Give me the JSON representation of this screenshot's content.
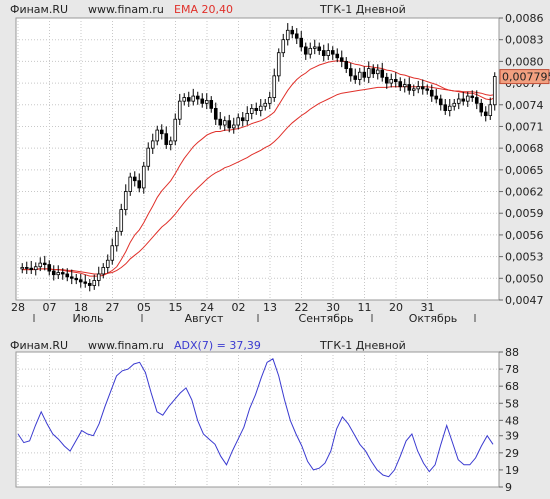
{
  "top_panel": {
    "source": "Финам.RU",
    "site": "www.finam.ru",
    "indicator": "EMA 20,40",
    "title": "ТГК-1 Дневной",
    "last_price": "0,007795"
  },
  "bottom_panel": {
    "source": "Финам.RU",
    "site": "www.finam.ru",
    "indicator": "ADX(7) = 37,39",
    "title": "ТГК-1 Дневной"
  },
  "colors": {
    "background": "#e8e8e8",
    "plot_bg": "#ffffff",
    "grid": "#c8c8c8",
    "ema": "#e0302a",
    "adx": "#3a3ad0",
    "candle_up": "#ffffff",
    "candle_down": "#000000",
    "price_tag": "#f2a080"
  },
  "chart_data": [
    {
      "type": "candlestick",
      "title": "ТГК-1 Дневной",
      "ylim": [
        0.0047,
        0.0086
      ],
      "y_ticks": [
        "0,0086",
        "0,0083",
        "0,0080",
        "0,0077",
        "0,0074",
        "0,0071",
        "0,0068",
        "0,0065",
        "0,0062",
        "0,0059",
        "0,0056",
        "0,0053",
        "0,0050",
        "0,0047"
      ],
      "x_day_ticks": [
        "28",
        "07",
        "18",
        "27",
        "05",
        "15",
        "24",
        "02",
        "13",
        "22",
        "30",
        "11",
        "20",
        "31"
      ],
      "x_month_labels": [
        "Июль",
        "Август",
        "Сентябрь",
        "Октябрь"
      ],
      "grid": true,
      "close": [
        0.00515,
        0.00514,
        0.00512,
        0.00516,
        0.00521,
        0.00519,
        0.0051,
        0.00505,
        0.00508,
        0.00506,
        0.00502,
        0.005,
        0.00498,
        0.00495,
        0.00493,
        0.0049,
        0.00497,
        0.00506,
        0.00515,
        0.00525,
        0.00545,
        0.00565,
        0.00595,
        0.0062,
        0.0064,
        0.00635,
        0.00625,
        0.00655,
        0.0068,
        0.0069,
        0.00705,
        0.007,
        0.00685,
        0.0069,
        0.0072,
        0.00745,
        0.0075,
        0.00745,
        0.00752,
        0.00748,
        0.00742,
        0.00746,
        0.00735,
        0.0072,
        0.00712,
        0.00718,
        0.00708,
        0.00712,
        0.00722,
        0.00718,
        0.00728,
        0.00735,
        0.00732,
        0.00738,
        0.00742,
        0.0075,
        0.0078,
        0.00812,
        0.0083,
        0.00843,
        0.00838,
        0.00832,
        0.0082,
        0.0081,
        0.00818,
        0.0082,
        0.00815,
        0.00808,
        0.00815,
        0.0081,
        0.00805,
        0.008,
        0.0079,
        0.0078,
        0.00775,
        0.00785,
        0.00778,
        0.0079,
        0.00783,
        0.00788,
        0.00778,
        0.0077,
        0.00775,
        0.00772,
        0.00765,
        0.00768,
        0.0076,
        0.00762,
        0.00765,
        0.00762,
        0.0076,
        0.00752,
        0.00748,
        0.0074,
        0.00732,
        0.00738,
        0.00742,
        0.00748,
        0.00745,
        0.00752,
        0.0075,
        0.00742,
        0.0073,
        0.00725,
        0.0074,
        0.00779
      ],
      "series": [
        {
          "name": "EMA 20",
          "values": [
            0.00512,
            0.00512,
            0.00512,
            0.00513,
            0.00513,
            0.00513,
            0.00513,
            0.00512,
            0.00512,
            0.00511,
            0.0051,
            0.00509,
            0.00508,
            0.00507,
            0.00505,
            0.00503,
            0.00503,
            0.00503,
            0.00504,
            0.00507,
            0.00511,
            0.00516,
            0.00526,
            0.00537,
            0.0055,
            0.0056,
            0.00567,
            0.00577,
            0.00589,
            0.006,
            0.00612,
            0.00621,
            0.00628,
            0.00635,
            0.00645,
            0.00656,
            0.00666,
            0.00674,
            0.00682,
            0.00688,
            0.00693,
            0.00698,
            0.00701,
            0.00703,
            0.00703,
            0.00705,
            0.00705,
            0.00706,
            0.00707,
            0.00709,
            0.00711,
            0.00714,
            0.00716,
            0.00718,
            0.00721,
            0.00725,
            0.0073,
            0.0074,
            0.0075,
            0.0076,
            0.00768,
            0.00775,
            0.0078,
            0.00784,
            0.00789,
            0.00792,
            0.00795,
            0.00797,
            0.00799,
            0.008,
            0.00801,
            0.008,
            0.008,
            0.00798,
            0.00796,
            0.00795,
            0.00793,
            0.00793,
            0.00792,
            0.00791,
            0.0079,
            0.00788,
            0.00787,
            0.00785,
            0.00782,
            0.00781,
            0.00779,
            0.00777,
            0.00776,
            0.00774,
            0.00772,
            0.0077,
            0.00768,
            0.00765,
            0.00762,
            0.0076,
            0.00759,
            0.00758,
            0.00757,
            0.00756,
            0.00756,
            0.00754,
            0.00751,
            0.00748,
            0.00747,
            0.0075
          ]
        },
        {
          "name": "EMA 40",
          "values": [
            0.00512,
            0.00512,
            0.00512,
            0.00512,
            0.00513,
            0.00513,
            0.00513,
            0.00512,
            0.00512,
            0.00512,
            0.00511,
            0.00511,
            0.0051,
            0.00509,
            0.00508,
            0.00507,
            0.00506,
            0.00506,
            0.00506,
            0.00507,
            0.00508,
            0.00511,
            0.00515,
            0.0052,
            0.00527,
            0.00532,
            0.00537,
            0.00543,
            0.0055,
            0.00557,
            0.00564,
            0.00571,
            0.00576,
            0.00582,
            0.00589,
            0.00597,
            0.00605,
            0.00612,
            0.00619,
            0.00625,
            0.00631,
            0.00637,
            0.00642,
            0.00646,
            0.00649,
            0.00653,
            0.00655,
            0.00658,
            0.00661,
            0.00664,
            0.00667,
            0.00671,
            0.00674,
            0.00677,
            0.00681,
            0.00684,
            0.00689,
            0.00695,
            0.00702,
            0.00709,
            0.00715,
            0.0072,
            0.00725,
            0.00729,
            0.00734,
            0.00738,
            0.00742,
            0.00745,
            0.00748,
            0.00751,
            0.00754,
            0.00756,
            0.00757,
            0.00758,
            0.00759,
            0.0076,
            0.00761,
            0.00762,
            0.00763,
            0.00764,
            0.00764,
            0.00764,
            0.00765,
            0.00765,
            0.00765,
            0.00765,
            0.00765,
            0.00765,
            0.00765,
            0.00765,
            0.00765,
            0.00764,
            0.00763,
            0.00762,
            0.00761,
            0.0076,
            0.00759,
            0.00759,
            0.00758,
            0.00758,
            0.00758,
            0.00757,
            0.00756,
            0.00754,
            0.00753,
            0.00754
          ]
        }
      ]
    },
    {
      "type": "line",
      "title": "ТГК-1 Дневной",
      "ylim": [
        9,
        88
      ],
      "y_ticks": [
        "88",
        "78",
        "68",
        "58",
        "48",
        "39",
        "29",
        "19",
        "9"
      ],
      "grid": true,
      "series": [
        {
          "name": "ADX(7)",
          "values": [
            40,
            35,
            36,
            45,
            53,
            46,
            40,
            37,
            33,
            30,
            36,
            42,
            40,
            39,
            46,
            56,
            65,
            74,
            77,
            78,
            81,
            82,
            76,
            64,
            53,
            51,
            56,
            60,
            64,
            67,
            60,
            48,
            40,
            37,
            34,
            27,
            22,
            30,
            37,
            44,
            55,
            63,
            73,
            82,
            84,
            74,
            60,
            48,
            40,
            33,
            24,
            19,
            20,
            23,
            30,
            43,
            50,
            46,
            40,
            34,
            30,
            24,
            19,
            16,
            15,
            19,
            27,
            36,
            40,
            30,
            23,
            18,
            22,
            34,
            45,
            35,
            25,
            22,
            22,
            26,
            33,
            39,
            34
          ]
        }
      ]
    }
  ]
}
